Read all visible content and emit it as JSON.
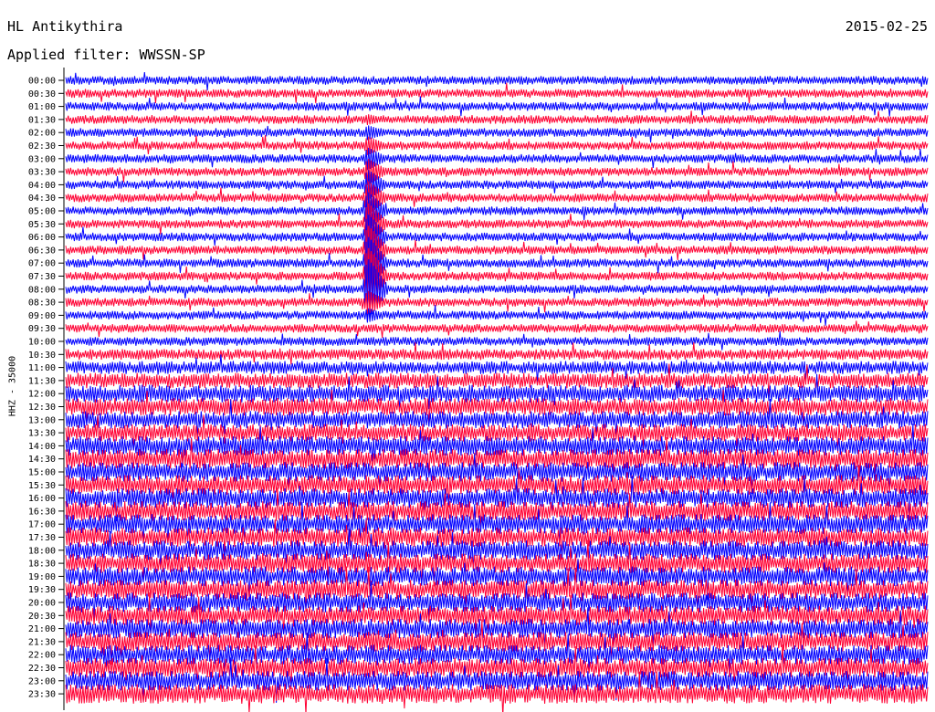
{
  "header": {
    "station": "HL Antikythira",
    "filter": "Applied filter: WWSSN-SP",
    "date": "2015-02-25"
  },
  "axis": {
    "ylabel": "HHZ - 35000"
  },
  "chart_data": {
    "type": "line",
    "title": "HL Antikythira",
    "subtitle": "Applied filter: WWSSN-SP",
    "date": "2015-02-25",
    "ylabel": "HHZ - 35000",
    "row_labels": [
      "00:00",
      "00:30",
      "01:00",
      "01:30",
      "02:00",
      "02:30",
      "03:00",
      "03:30",
      "04:00",
      "04:30",
      "05:00",
      "05:30",
      "06:00",
      "06:30",
      "07:00",
      "07:30",
      "08:00",
      "08:30",
      "09:00",
      "09:30",
      "10:00",
      "10:30",
      "11:00",
      "11:30",
      "12:00",
      "12:30",
      "13:00",
      "13:30",
      "14:00",
      "14:30",
      "15:00",
      "15:30",
      "16:00",
      "16:30",
      "17:00",
      "17:30",
      "18:00",
      "18:30",
      "19:00",
      "19:30",
      "20:00",
      "20:30",
      "21:00",
      "21:30",
      "22:00",
      "22:30",
      "23:00",
      "23:30"
    ],
    "series_colors": [
      "#0000ff",
      "#ff0033"
    ],
    "noise_level_by_row": [
      4,
      4,
      4,
      4,
      4,
      4,
      4,
      4,
      4,
      4,
      4,
      4,
      4,
      4,
      4,
      4,
      4,
      4,
      4,
      4,
      4,
      5,
      6,
      7,
      8,
      8,
      8,
      8,
      9,
      9,
      9,
      9,
      9,
      9,
      9,
      9,
      9,
      9,
      9,
      9,
      9,
      9,
      9,
      9,
      9,
      9,
      9,
      9
    ],
    "event": {
      "start_row_label": "01:30",
      "peak_row_label": "08:00",
      "end_row_label": "10:00",
      "minute_in_row": 10.5
    },
    "grid": false
  }
}
